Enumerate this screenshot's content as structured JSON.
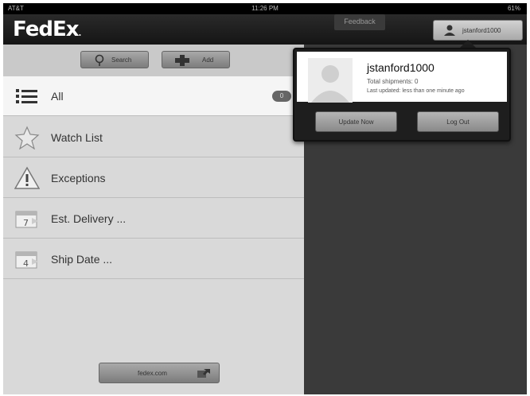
{
  "status_bar": {
    "carrier": "AT&T",
    "time": "11:26 PM",
    "battery": "61%"
  },
  "header": {
    "logo": "FedEx",
    "logo_suffix": ".",
    "feedback_label": "Feedback",
    "user_label": "jstanford1000"
  },
  "sidebar": {
    "search_label": "Search",
    "add_label": "Add",
    "items": [
      {
        "label": "All",
        "count": "0",
        "icon": "list-icon"
      },
      {
        "label": "Watch List",
        "icon": "star-icon"
      },
      {
        "label": "Exceptions",
        "icon": "warning-icon"
      },
      {
        "label": "Est. Delivery ...",
        "icon": "calendar-7-icon",
        "icon_text": "7"
      },
      {
        "label": "Ship Date ...",
        "icon": "calendar-4-icon",
        "icon_text": "4"
      }
    ],
    "footer_link": "fedex.com"
  },
  "popover": {
    "username": "jstanford1000",
    "total_shipments": "Total shipments: 0",
    "last_updated": "Last updated: less than one minute ago",
    "update_label": "Update Now",
    "logout_label": "Log Out"
  }
}
